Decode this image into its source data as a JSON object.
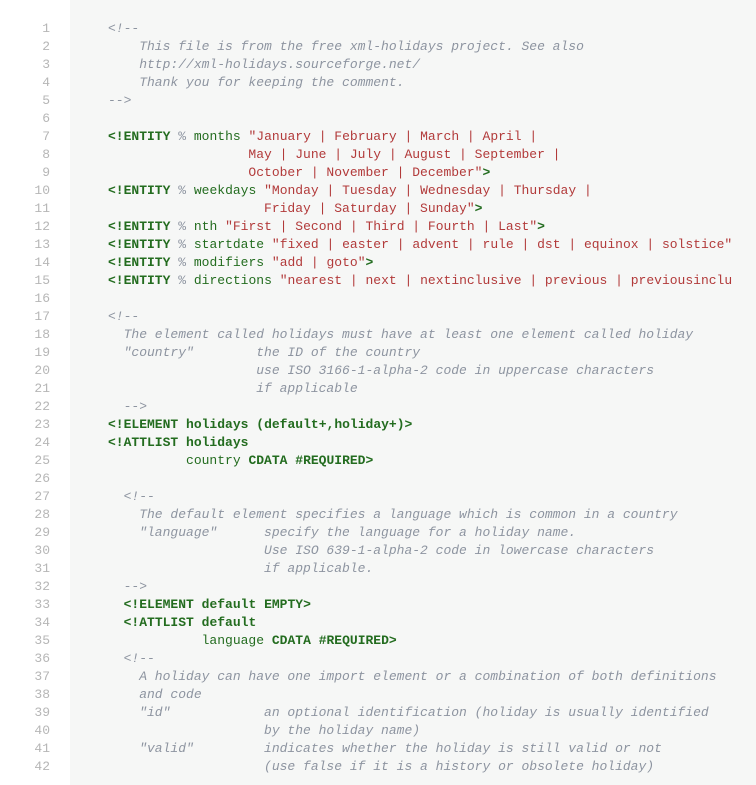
{
  "gutter": [
    "1",
    "2",
    "3",
    "4",
    "5",
    "6",
    "7",
    "8",
    "9",
    "10",
    "11",
    "12",
    "13",
    "14",
    "15",
    "16",
    "17",
    "18",
    "19",
    "20",
    "21",
    "22",
    "23",
    "24",
    "25",
    "26",
    "27",
    "28",
    "29",
    "30",
    "31",
    "32",
    "33",
    "34",
    "35",
    "36",
    "37",
    "38",
    "39",
    "40",
    "41",
    "42"
  ],
  "lines": [
    [
      {
        "c": "c",
        "t": "<!--"
      }
    ],
    [
      {
        "c": "c",
        "t": "    This file is from the free xml-holidays project. See also"
      }
    ],
    [
      {
        "c": "c",
        "t": "    http://xml-holidays.sourceforge.net/"
      }
    ],
    [
      {
        "c": "c",
        "t": "    Thank you for keeping the comment."
      }
    ],
    [
      {
        "c": "c",
        "t": "-->"
      }
    ],
    [],
    [
      {
        "c": "pun",
        "t": "<!ENTITY"
      },
      {
        "t": " "
      },
      {
        "c": "pct",
        "t": "%"
      },
      {
        "t": " "
      },
      {
        "c": "nm",
        "t": "months"
      },
      {
        "t": " "
      },
      {
        "c": "str",
        "t": "\"January | February | March | April |"
      }
    ],
    [
      {
        "c": "str",
        "t": "                  May | June | July | August | September |"
      }
    ],
    [
      {
        "c": "str",
        "t": "                  October | November | December\""
      },
      {
        "c": "pun",
        "t": ">"
      }
    ],
    [
      {
        "c": "pun",
        "t": "<!ENTITY"
      },
      {
        "t": " "
      },
      {
        "c": "pct",
        "t": "%"
      },
      {
        "t": " "
      },
      {
        "c": "nm",
        "t": "weekdays"
      },
      {
        "t": " "
      },
      {
        "c": "str",
        "t": "\"Monday | Tuesday | Wednesday | Thursday |"
      }
    ],
    [
      {
        "c": "str",
        "t": "                    Friday | Saturday | Sunday\""
      },
      {
        "c": "pun",
        "t": ">"
      }
    ],
    [
      {
        "c": "pun",
        "t": "<!ENTITY"
      },
      {
        "t": " "
      },
      {
        "c": "pct",
        "t": "%"
      },
      {
        "t": " "
      },
      {
        "c": "nm",
        "t": "nth"
      },
      {
        "t": " "
      },
      {
        "c": "str",
        "t": "\"First | Second | Third | Fourth | Last\""
      },
      {
        "c": "pun",
        "t": ">"
      }
    ],
    [
      {
        "c": "pun",
        "t": "<!ENTITY"
      },
      {
        "t": " "
      },
      {
        "c": "pct",
        "t": "%"
      },
      {
        "t": " "
      },
      {
        "c": "nm",
        "t": "startdate"
      },
      {
        "t": " "
      },
      {
        "c": "str",
        "t": "\"fixed | easter | advent | rule | dst | equinox | solstice\""
      }
    ],
    [
      {
        "c": "pun",
        "t": "<!ENTITY"
      },
      {
        "t": " "
      },
      {
        "c": "pct",
        "t": "%"
      },
      {
        "t": " "
      },
      {
        "c": "nm",
        "t": "modifiers"
      },
      {
        "t": " "
      },
      {
        "c": "str",
        "t": "\"add | goto\""
      },
      {
        "c": "pun",
        "t": ">"
      }
    ],
    [
      {
        "c": "pun",
        "t": "<!ENTITY"
      },
      {
        "t": " "
      },
      {
        "c": "pct",
        "t": "%"
      },
      {
        "t": " "
      },
      {
        "c": "nm",
        "t": "directions"
      },
      {
        "t": " "
      },
      {
        "c": "str",
        "t": "\"nearest | next | nextinclusive | previous | previousinclu"
      }
    ],
    [],
    [
      {
        "c": "c",
        "t": "<!--"
      }
    ],
    [
      {
        "c": "c",
        "t": "  The element called holidays must have at least one element called holiday"
      }
    ],
    [
      {
        "c": "c",
        "t": "  \"country\"        the ID of the country"
      }
    ],
    [
      {
        "c": "c",
        "t": "                   use ISO 3166-1-alpha-2 code in uppercase characters"
      }
    ],
    [
      {
        "c": "c",
        "t": "                   if applicable"
      }
    ],
    [
      {
        "c": "c",
        "t": "  -->"
      }
    ],
    [
      {
        "c": "pun",
        "t": "<!ELEMENT"
      },
      {
        "t": " "
      },
      {
        "c": "kw",
        "t": "holidays"
      },
      {
        "t": " "
      },
      {
        "c": "blk",
        "t": "("
      },
      {
        "c": "kw",
        "t": "default"
      },
      {
        "c": "blk",
        "t": "+"
      },
      {
        "c": "blk",
        "t": ","
      },
      {
        "c": "kw",
        "t": "holiday"
      },
      {
        "c": "blk",
        "t": "+"
      },
      {
        "c": "blk",
        "t": ")"
      },
      {
        "c": "pun",
        "t": ">"
      }
    ],
    [
      {
        "c": "pun",
        "t": "<!ATTLIST"
      },
      {
        "t": " "
      },
      {
        "c": "kw",
        "t": "holidays"
      }
    ],
    [
      {
        "t": "          "
      },
      {
        "c": "nm",
        "t": "country"
      },
      {
        "t": " "
      },
      {
        "c": "cd",
        "t": "CDATA"
      },
      {
        "t": " "
      },
      {
        "c": "cd",
        "t": "#REQUIRED"
      },
      {
        "c": "pun",
        "t": ">"
      }
    ],
    [],
    [
      {
        "c": "c",
        "t": "  <!--"
      }
    ],
    [
      {
        "c": "c",
        "t": "    The default element specifies a language which is common in a country"
      }
    ],
    [
      {
        "c": "c",
        "t": "    \"language\"      specify the language for a holiday name."
      }
    ],
    [
      {
        "c": "c",
        "t": "                    Use ISO 639-1-alpha-2 code in lowercase characters"
      }
    ],
    [
      {
        "c": "c",
        "t": "                    if applicable."
      }
    ],
    [
      {
        "c": "c",
        "t": "  -->"
      }
    ],
    [
      {
        "t": "  "
      },
      {
        "c": "pun",
        "t": "<!ELEMENT"
      },
      {
        "t": " "
      },
      {
        "c": "kw",
        "t": "default"
      },
      {
        "t": " "
      },
      {
        "c": "cd",
        "t": "EMPTY"
      },
      {
        "c": "pun",
        "t": ">"
      }
    ],
    [
      {
        "t": "  "
      },
      {
        "c": "pun",
        "t": "<!ATTLIST"
      },
      {
        "t": " "
      },
      {
        "c": "kw",
        "t": "default"
      }
    ],
    [
      {
        "t": "            "
      },
      {
        "c": "nm",
        "t": "language"
      },
      {
        "t": " "
      },
      {
        "c": "cd",
        "t": "CDATA"
      },
      {
        "t": " "
      },
      {
        "c": "cd",
        "t": "#REQUIRED"
      },
      {
        "c": "pun",
        "t": ">"
      }
    ],
    [
      {
        "c": "c",
        "t": "  <!--"
      }
    ],
    [
      {
        "c": "c",
        "t": "    A holiday can have one import element or a combination of both definitions"
      }
    ],
    [
      {
        "c": "c",
        "t": "    and code"
      }
    ],
    [
      {
        "c": "c",
        "t": "    \"id\"            an optional identification (holiday is usually identified"
      }
    ],
    [
      {
        "c": "c",
        "t": "                    by the holiday name)"
      }
    ],
    [
      {
        "c": "c",
        "t": "    \"valid\"         indicates whether the holiday is still valid or not"
      }
    ],
    [
      {
        "c": "c",
        "t": "                    (use false if it is a history or obsolete holiday)"
      }
    ]
  ]
}
